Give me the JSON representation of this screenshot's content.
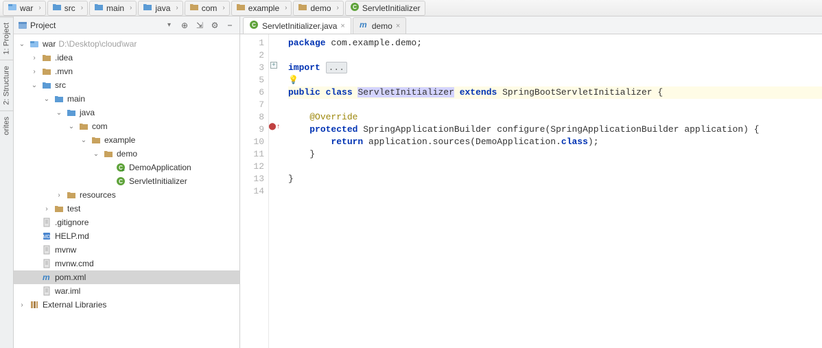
{
  "breadcrumb": [
    {
      "label": "war",
      "icon": "module"
    },
    {
      "label": "src",
      "icon": "folder-blue"
    },
    {
      "label": "main",
      "icon": "folder-blue"
    },
    {
      "label": "java",
      "icon": "folder-blue"
    },
    {
      "label": "com",
      "icon": "folder"
    },
    {
      "label": "example",
      "icon": "folder"
    },
    {
      "label": "demo",
      "icon": "folder"
    },
    {
      "label": "ServletInitializer",
      "icon": "class"
    }
  ],
  "sideTabs": [
    "1: Project",
    "2: Structure",
    "orites"
  ],
  "projectPanel": {
    "title": "Project",
    "rootHint": "D:\\Desktop\\cloud\\war"
  },
  "tree": [
    {
      "depth": 0,
      "twisty": "open",
      "icon": "module",
      "label": "war",
      "hint": "D:\\Desktop\\cloud\\war"
    },
    {
      "depth": 1,
      "twisty": "closed",
      "icon": "folder",
      "label": ".idea"
    },
    {
      "depth": 1,
      "twisty": "closed",
      "icon": "folder",
      "label": ".mvn"
    },
    {
      "depth": 1,
      "twisty": "open",
      "icon": "folder-blue",
      "label": "src"
    },
    {
      "depth": 2,
      "twisty": "open",
      "icon": "folder-blue",
      "label": "main"
    },
    {
      "depth": 3,
      "twisty": "open",
      "icon": "folder-blue",
      "label": "java"
    },
    {
      "depth": 4,
      "twisty": "open",
      "icon": "folder",
      "label": "com"
    },
    {
      "depth": 5,
      "twisty": "open",
      "icon": "folder",
      "label": "example"
    },
    {
      "depth": 6,
      "twisty": "open",
      "icon": "folder",
      "label": "demo"
    },
    {
      "depth": 7,
      "twisty": "none",
      "icon": "class-run",
      "label": "DemoApplication"
    },
    {
      "depth": 7,
      "twisty": "none",
      "icon": "class",
      "label": "ServletInitializer"
    },
    {
      "depth": 3,
      "twisty": "closed",
      "icon": "folder",
      "label": "resources"
    },
    {
      "depth": 2,
      "twisty": "closed",
      "icon": "folder",
      "label": "test"
    },
    {
      "depth": 1,
      "twisty": "none",
      "icon": "file",
      "label": ".gitignore"
    },
    {
      "depth": 1,
      "twisty": "none",
      "icon": "md",
      "label": "HELP.md"
    },
    {
      "depth": 1,
      "twisty": "none",
      "icon": "file",
      "label": "mvnw"
    },
    {
      "depth": 1,
      "twisty": "none",
      "icon": "file",
      "label": "mvnw.cmd"
    },
    {
      "depth": 1,
      "twisty": "none",
      "icon": "maven",
      "label": "pom.xml",
      "selected": true
    },
    {
      "depth": 1,
      "twisty": "none",
      "icon": "file",
      "label": "war.iml"
    },
    {
      "depth": 0,
      "twisty": "closed",
      "icon": "lib",
      "label": "External Libraries"
    }
  ],
  "editorTabs": [
    {
      "label": "ServletInitializer.java",
      "icon": "class",
      "active": true,
      "closable": true
    },
    {
      "label": "demo",
      "icon": "maven",
      "active": false,
      "closable": true
    }
  ],
  "code": {
    "lines": [
      {
        "n": 1,
        "tokens": [
          {
            "t": "kw",
            "v": "package"
          },
          {
            "t": "sp",
            "v": " "
          },
          {
            "t": "txt",
            "v": "com.example.demo;"
          }
        ]
      },
      {
        "n": 2,
        "tokens": []
      },
      {
        "n": 3,
        "expand": true,
        "tokens": [
          {
            "t": "kw",
            "v": "import"
          },
          {
            "t": "sp",
            "v": " "
          },
          {
            "t": "fold",
            "v": "..."
          }
        ]
      },
      {
        "n": 5,
        "bulb": true,
        "tokens": []
      },
      {
        "n": 6,
        "hl": true,
        "caret": true,
        "tokens": [
          {
            "t": "kw",
            "v": "public"
          },
          {
            "t": "sp",
            "v": " "
          },
          {
            "t": "kw",
            "v": "class"
          },
          {
            "t": "sp",
            "v": " "
          },
          {
            "t": "sel",
            "v": "ServletInitializer"
          },
          {
            "t": "sp",
            "v": " "
          },
          {
            "t": "kw",
            "v": "extends"
          },
          {
            "t": "sp",
            "v": " "
          },
          {
            "t": "txt",
            "v": "SpringBootServletInitializer {"
          }
        ]
      },
      {
        "n": 7,
        "tokens": []
      },
      {
        "n": 8,
        "tokens": [
          {
            "t": "sp",
            "v": "    "
          },
          {
            "t": "anno",
            "v": "@Override"
          }
        ]
      },
      {
        "n": 9,
        "gicon": "override",
        "tokens": [
          {
            "t": "sp",
            "v": "    "
          },
          {
            "t": "kw",
            "v": "protected"
          },
          {
            "t": "sp",
            "v": " "
          },
          {
            "t": "txt",
            "v": "SpringApplicationBuilder configure(SpringApplicationBuilder application) {"
          }
        ]
      },
      {
        "n": 10,
        "tokens": [
          {
            "t": "sp",
            "v": "        "
          },
          {
            "t": "kw",
            "v": "return"
          },
          {
            "t": "sp",
            "v": " "
          },
          {
            "t": "txt",
            "v": "application.sources(DemoApplication."
          },
          {
            "t": "kw",
            "v": "class"
          },
          {
            "t": "txt",
            "v": ");"
          }
        ]
      },
      {
        "n": 11,
        "tokens": [
          {
            "t": "sp",
            "v": "    "
          },
          {
            "t": "txt",
            "v": "}"
          }
        ]
      },
      {
        "n": 12,
        "tokens": []
      },
      {
        "n": 13,
        "tokens": [
          {
            "t": "txt",
            "v": "}"
          }
        ]
      },
      {
        "n": 14,
        "tokens": []
      }
    ]
  }
}
